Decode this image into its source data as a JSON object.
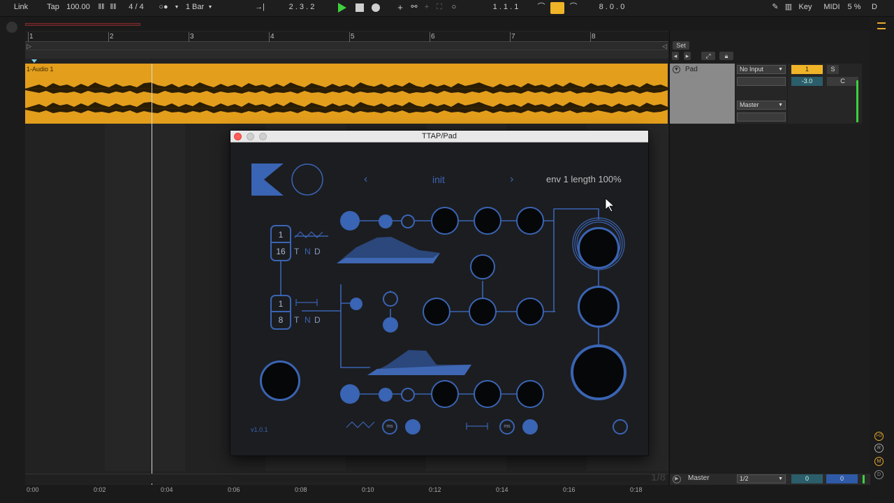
{
  "transport": {
    "link": "Link",
    "tap": "Tap",
    "tempo": "100.00",
    "signature": "4 / 4",
    "quantize": "1 Bar",
    "arrangement_position": "2 .  3 .  2",
    "loop_start": "1 .  1 .  1",
    "loop_length": "8 .  0 .  0",
    "key": "Key",
    "midi": "MIDI",
    "cpu": "5 %",
    "d": "D"
  },
  "ruler": {
    "bars": [
      "1",
      "2",
      "3",
      "4",
      "5",
      "6",
      "7",
      "8"
    ]
  },
  "clip": {
    "label": "1-Audio 1"
  },
  "timeline": {
    "labels": [
      "0:00",
      "0:02",
      "0:04",
      "0:06",
      "0:08",
      "0:10",
      "0:12",
      "0:14",
      "0:16",
      "0:18"
    ],
    "zoom": "1/8"
  },
  "session": {
    "set_label": "Set",
    "track_name": "Pad",
    "input": "No Input",
    "output": "Master",
    "track_number": "1",
    "solo": "S",
    "volume": "-3.0",
    "pan": "C",
    "master_name": "Master",
    "master_out": "1/2",
    "master_val_a": "0",
    "master_val_b": "0"
  },
  "sidebar": {
    "io": "I-O",
    "r": "R",
    "m": "M",
    "d": "D"
  },
  "plugin": {
    "window_title": "TTAP/Pad",
    "preset_name": "init",
    "prev": "‹",
    "next": "›",
    "param_display": "env 1 length 100%",
    "version": "v1.0.1",
    "step1_top": "1",
    "step1_bottom": "16",
    "step2_top": "1",
    "step2_bottom": "8",
    "tnd_t": "T",
    "tnd_n": "N",
    "tnd_d": "D",
    "ms1": "ms",
    "ms2": "ms"
  },
  "colors": {
    "clip": "#e39e1c",
    "accent_blue": "#3a64b4",
    "loop_active": "#f0b428",
    "play_green": "#3ed13e"
  }
}
